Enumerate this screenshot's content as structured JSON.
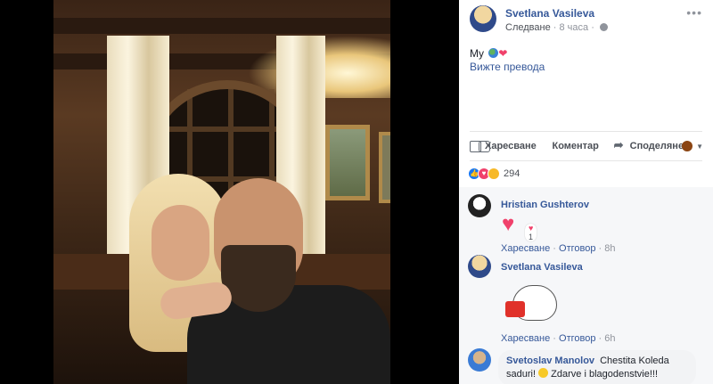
{
  "post": {
    "author": "Svetlana Vasileva",
    "follow_label": "Следване",
    "time": "8 часа",
    "more": "•••",
    "text": "My",
    "see_translation": "Вижте превода"
  },
  "actions": {
    "like": "Харесване",
    "comment": "Коментар",
    "share": "Споделяне"
  },
  "reactions": {
    "count": "294"
  },
  "comments": [
    {
      "author": "Hristian Gushterov",
      "reaction_count": "1",
      "like": "Харесване",
      "reply": "Отговор",
      "time": "8h"
    },
    {
      "author": "Svetlana Vasileva",
      "like": "Харесване",
      "reply": "Отговор",
      "time": "6h"
    },
    {
      "author": "Svetoslav Manolov",
      "text_1": "Chestita Koleda",
      "text_2": "saduri!",
      "text_3": "Zdarve i blagodenstvie!!!"
    }
  ],
  "colors": {
    "link": "#365899",
    "love": "#f0416b",
    "like": "#1877f2"
  }
}
